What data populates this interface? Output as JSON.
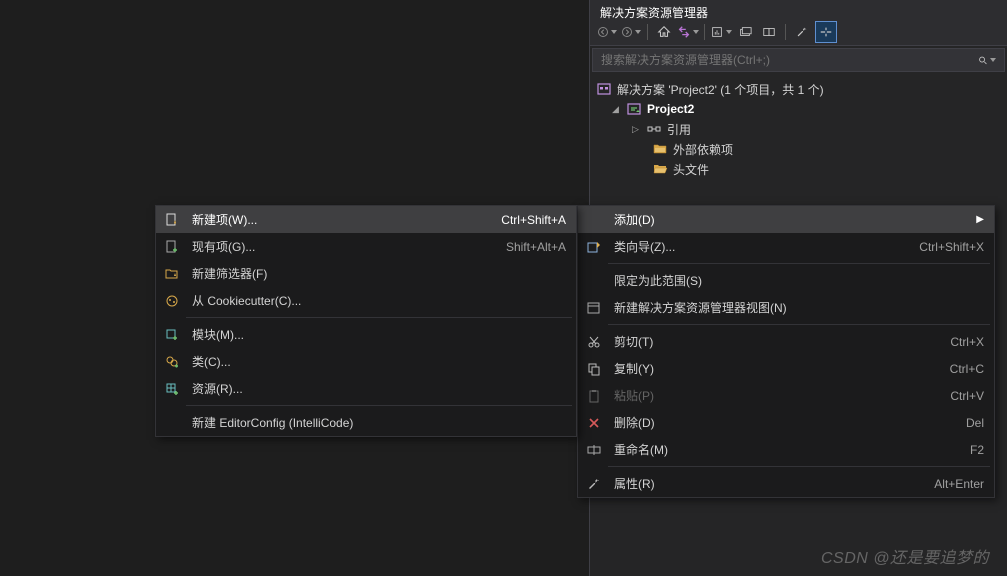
{
  "panel": {
    "title": "解决方案资源管理器",
    "search_placeholder": "搜索解决方案资源管理器(Ctrl+;)"
  },
  "tree": {
    "solution_label": "解决方案 'Project2' (1 个项目，共 1 个)",
    "project_label": "Project2",
    "references_label": "引用",
    "external_deps_label": "外部依赖项",
    "headers_label": "头文件"
  },
  "ctx1": {
    "addLabel": "添加(D)",
    "classWizLabel": "类向导(Z)...",
    "classWizKey": "Ctrl+Shift+X",
    "scopeLabel": "限定为此范围(S)",
    "newViewLabel": "新建解决方案资源管理器视图(N)",
    "cutLabel": "剪切(T)",
    "cutKey": "Ctrl+X",
    "copyLabel": "复制(Y)",
    "copyKey": "Ctrl+C",
    "pasteLabel": "粘贴(P)",
    "pasteKey": "Ctrl+V",
    "deleteLabel": "删除(D)",
    "deleteKey": "Del",
    "renameLabel": "重命名(M)",
    "renameKey": "F2",
    "propsLabel": "属性(R)",
    "propsKey": "Alt+Enter"
  },
  "ctx2": {
    "newItemLabel": "新建项(W)...",
    "newItemKey": "Ctrl+Shift+A",
    "existItemLabel": "现有项(G)...",
    "existItemKey": "Shift+Alt+A",
    "newFilterLabel": "新建筛选器(F)",
    "cookieLabel": "从 Cookiecutter(C)...",
    "moduleLabel": "模块(M)...",
    "classLabel": "类(C)...",
    "resourceLabel": "资源(R)...",
    "editorCfgLabel": "新建 EditorConfig (IntelliCode)"
  },
  "watermark": "CSDN @还是要追梦的"
}
